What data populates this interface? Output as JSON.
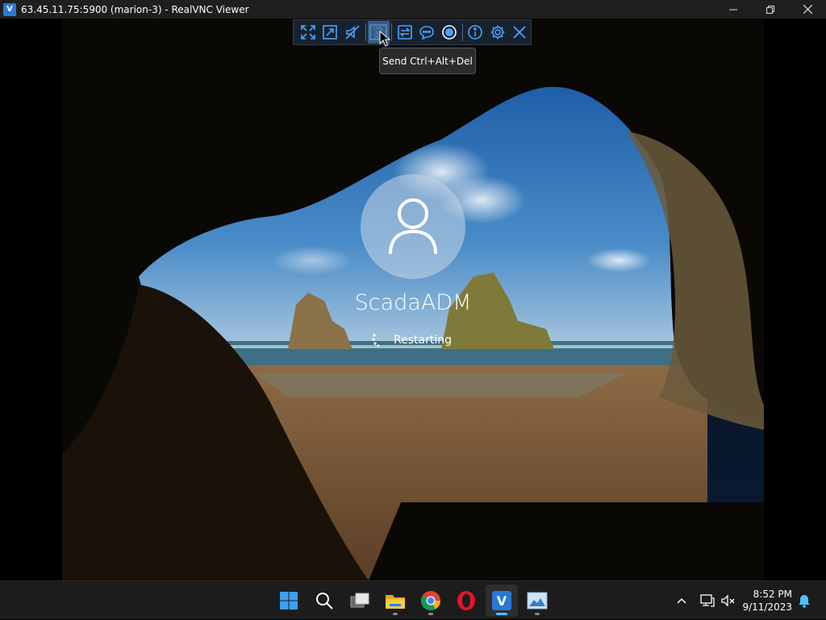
{
  "window": {
    "title": "63.45.11.75:5900 (marion-3) - RealVNC Viewer",
    "app_icon": "realvnc-icon",
    "controls": [
      "minimize-icon",
      "maximize-icon",
      "close-icon"
    ]
  },
  "vnc_toolbar": {
    "buttons": [
      {
        "name": "full-screen-icon"
      },
      {
        "name": "scale-icon"
      },
      {
        "name": "audio-muted-icon"
      },
      {
        "name": "ctrl-alt-del-icon",
        "label": "CTRL ALT DEL",
        "active": true
      },
      {
        "name": "file-transfer-icon"
      },
      {
        "name": "chat-icon"
      },
      {
        "name": "record-icon"
      },
      {
        "name": "info-icon"
      },
      {
        "name": "settings-icon"
      },
      {
        "name": "close-session-icon"
      }
    ],
    "tooltip": "Send Ctrl+Alt+Del"
  },
  "lock_screen": {
    "username": "ScadaADM",
    "status": "Restarting"
  },
  "taskbar": {
    "apps": [
      {
        "name": "windows-start-icon"
      },
      {
        "name": "search-icon"
      },
      {
        "name": "task-view-icon"
      },
      {
        "name": "file-explorer-icon",
        "running": true
      },
      {
        "name": "chrome-icon",
        "running": true
      },
      {
        "name": "opera-icon"
      },
      {
        "name": "realvnc-icon",
        "running": true,
        "active": true
      },
      {
        "name": "photos-icon",
        "running": true
      }
    ],
    "tray": {
      "icons": [
        "chevron-up-icon",
        "network-icon",
        "speaker-muted-icon",
        "notification-bell-icon"
      ],
      "time": "8:52 PM",
      "date": "9/11/2023"
    }
  },
  "colors": {
    "accent": "#4cc2ff",
    "toolbar_bg": "#18222e",
    "vnc_blue": "#2b78d4"
  }
}
